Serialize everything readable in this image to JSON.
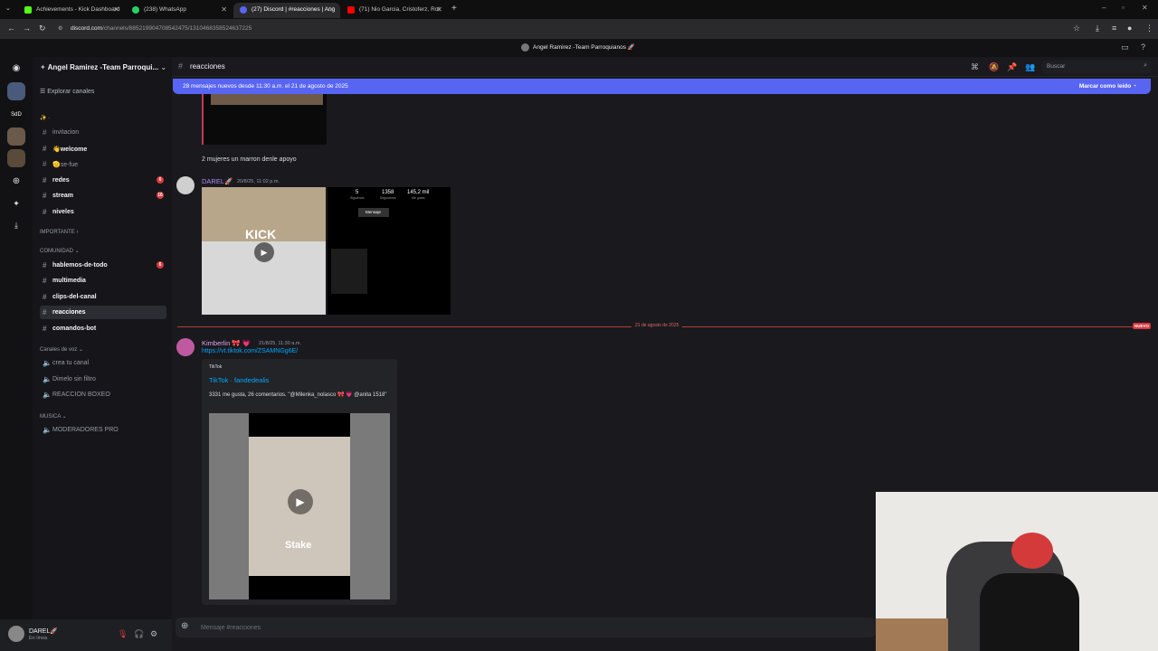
{
  "browser": {
    "tabs": [
      {
        "label": "Achievements - Kick Dashboard",
        "color": "#53fc18"
      },
      {
        "label": "(238) WhatsApp",
        "color": "#25d366"
      },
      {
        "label": "(27) Discord | #reacciones | Ang",
        "color": "#5865f2"
      },
      {
        "label": "(71) Nio Garcia, Cristoferz, Rol",
        "color": "#ff0000"
      }
    ],
    "new_tab": "+",
    "url_host": "discord.com",
    "url_path": "/channels/885219904708542475/1310468358524637225"
  },
  "discord_top_title": "Angel Ramirez -Team Parroquianos 🚀",
  "server": {
    "name": "Angel Ramirez -Team Parroqui...",
    "browse_channels": "Explorar canales",
    "top_emoji": "✨ ·",
    "channels_top": [
      {
        "label": "invitacion",
        "bright": false
      },
      {
        "label": "👋welcome",
        "bright": true
      },
      {
        "label": "🫡se-fue",
        "bright": false
      },
      {
        "label": "redes",
        "bright": true,
        "badge": "6"
      },
      {
        "label": "stream",
        "bright": true,
        "badge": "16"
      },
      {
        "label": "niveles",
        "bright": true
      }
    ],
    "cat_importante": "IMPORTANTE ›",
    "cat_comunidad": "COMUNIDAD ⌄",
    "channels_comunidad": [
      {
        "label": "hablemos-de-todo",
        "bright": true,
        "badge": "6"
      },
      {
        "label": "multimedia",
        "bright": true
      },
      {
        "label": "clips-del-canal",
        "bright": true
      },
      {
        "label": "reacciones",
        "bright": true,
        "selected": true
      },
      {
        "label": "comandos-bot",
        "bright": true
      }
    ],
    "cat_voz": "Canales de voz ⌄",
    "voice_channels": [
      "crea tu canal",
      "Dimelo sin filtro",
      "REACCION BOXEO"
    ],
    "cat_musica": "MUSICA ⌄",
    "music_channels": [
      "MODERADORES PRO"
    ]
  },
  "user": {
    "name": "DAREL🚀",
    "status": "En línea"
  },
  "channel": {
    "name": "reacciones",
    "search_placeholder": "Buscar"
  },
  "new_messages": {
    "text": "28 mensajes nuevos desde 11:30 a.m. el 21 de agosto de 2025",
    "action": "Marcar como leído"
  },
  "messages": {
    "m1_text": "2 mujeres un marron denle apoyo",
    "m2_author": "DAREL🚀",
    "m2_time": "20/8/25, 11:02 p.m.",
    "m2_profile": {
      "stat1": "5",
      "stat1_label": "Siguiendo",
      "stat2": "1358",
      "stat2_label": "Seguidores",
      "stat3": "145,2 mil",
      "stat3_label": "Me gusta",
      "button": "Mensaje"
    },
    "m2_video_label": "KICK",
    "divider_label": "21 de agosto de 2025",
    "divider_badge": "NUEVO",
    "m3_author": "Kimberlin 🎀 💗",
    "m3_time": "21/8/25, 11:30 a.m.",
    "m3_link": "https://vt.tiktok.com/ZSAMNGg6E/",
    "embed_provider": "TikTok",
    "embed_title": "TikTok · fandedealis",
    "embed_desc": "3331 me gusta, 26 comentarios. \"@Milenka_nolasco 🎀 💗 @anita 1518\"",
    "embed_video_caption": "Stake"
  },
  "composer": {
    "placeholder": "Mensaje #reacciones"
  }
}
